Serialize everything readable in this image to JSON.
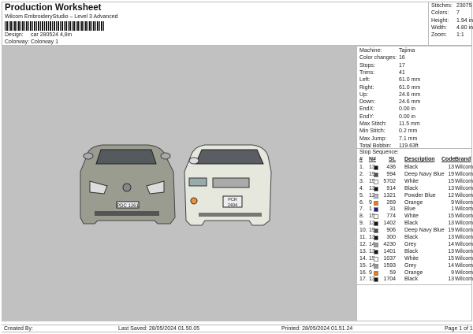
{
  "header": {
    "title": "Production Worksheet",
    "subtitle": "Wilcom EmbroideryStudio – Level 3 Advanced",
    "design_label": "Design:",
    "design_value": "car 280524 4,8in",
    "colorway_label": "Colorway:",
    "colorway_value": "Colorway 1"
  },
  "stats": [
    {
      "label": "Stitches:",
      "value": "23075"
    },
    {
      "label": "Colors:",
      "value": "7"
    },
    {
      "label": "Height:",
      "value": "1.94 in"
    },
    {
      "label": "Width:",
      "value": "4.80 in"
    },
    {
      "label": "Zoom:",
      "value": "1:1"
    }
  ],
  "info": [
    {
      "label": "Machine:",
      "value": "Tajima"
    },
    {
      "label": "Color changes:",
      "value": "16"
    },
    {
      "label": "Stops:",
      "value": "17"
    },
    {
      "label": "Trims:",
      "value": "41"
    },
    {
      "label": "Left:",
      "value": "61.0 mm"
    },
    {
      "label": "Right:",
      "value": "61.0 mm"
    },
    {
      "label": "Up:",
      "value": "24.6 mm"
    },
    {
      "label": "Down:",
      "value": "24.6 mm"
    },
    {
      "label": "EndX:",
      "value": "0.00 in"
    },
    {
      "label": "EndY:",
      "value": "0.00 in"
    },
    {
      "label": "Max Stitch:",
      "value": "11.5 mm"
    },
    {
      "label": "Min Stitch:",
      "value": "0.2 mm"
    },
    {
      "label": "Max Jump:",
      "value": "7.1 mm"
    },
    {
      "label": "Total Bobbin:",
      "value": "119.63ft"
    }
  ],
  "stop_sequence": {
    "title": "Stop Sequence:",
    "headers": [
      "#",
      "N#",
      "St.",
      "Description",
      "Code",
      "Brand"
    ],
    "rows": [
      {
        "n": "1.",
        "needle": "13",
        "color": "#111111",
        "st": "436",
        "desc": "Black",
        "code": "13",
        "brand": "Wilcom"
      },
      {
        "n": "2.",
        "needle": "19",
        "color": "#4a4a66",
        "st": "994",
        "desc": "Deep Navy Blue",
        "code": "19",
        "brand": "Wilcom"
      },
      {
        "n": "3.",
        "needle": "15",
        "color": "#ffffff",
        "st": "5702",
        "desc": "White",
        "code": "15",
        "brand": "Wilcom"
      },
      {
        "n": "4.",
        "needle": "13",
        "color": "#111111",
        "st": "914",
        "desc": "Black",
        "code": "13",
        "brand": "Wilcom"
      },
      {
        "n": "5.",
        "needle": "12",
        "color": "#b8b8e0",
        "st": "1321",
        "desc": "Powder Blue",
        "code": "12",
        "brand": "Wilcom"
      },
      {
        "n": "6.",
        "needle": "9",
        "color": "#f07a10",
        "st": "269",
        "desc": "Orange",
        "code": "9",
        "brand": "Wilcom"
      },
      {
        "n": "7.",
        "needle": "1",
        "color": "#1a1a80",
        "st": "31",
        "desc": "Blue",
        "code": "1",
        "brand": "Wilcom"
      },
      {
        "n": "8.",
        "needle": "15",
        "color": "#ffffff",
        "st": "774",
        "desc": "White",
        "code": "15",
        "brand": "Wilcom"
      },
      {
        "n": "9.",
        "needle": "13",
        "color": "#111111",
        "st": "1402",
        "desc": "Black",
        "code": "13",
        "brand": "Wilcom"
      },
      {
        "n": "10.",
        "needle": "19",
        "color": "#4a4a66",
        "st": "906",
        "desc": "Deep Navy Blue",
        "code": "19",
        "brand": "Wilcom"
      },
      {
        "n": "11.",
        "needle": "13",
        "color": "#111111",
        "st": "300",
        "desc": "Black",
        "code": "13",
        "brand": "Wilcom"
      },
      {
        "n": "12.",
        "needle": "14",
        "color": "#999999",
        "st": "4230",
        "desc": "Grey",
        "code": "14",
        "brand": "Wilcom"
      },
      {
        "n": "13.",
        "needle": "13",
        "color": "#111111",
        "st": "1401",
        "desc": "Black",
        "code": "13",
        "brand": "Wilcom"
      },
      {
        "n": "14.",
        "needle": "15",
        "color": "#ffffff",
        "st": "1037",
        "desc": "White",
        "code": "15",
        "brand": "Wilcom"
      },
      {
        "n": "15.",
        "needle": "14",
        "color": "#999999",
        "st": "1593",
        "desc": "Grey",
        "code": "14",
        "brand": "Wilcom"
      },
      {
        "n": "16.",
        "needle": "9",
        "color": "#f07a10",
        "st": "59",
        "desc": "Orange",
        "code": "9",
        "brand": "Wilcom"
      },
      {
        "n": "17.",
        "needle": "13",
        "color": "#111111",
        "st": "1704",
        "desc": "Black",
        "code": "13",
        "brand": "Wilcom"
      }
    ]
  },
  "plates": {
    "car1": "PDC 1261",
    "car2_top": "PCR",
    "car2_bottom": "2494"
  },
  "footer": {
    "created_by": "Created By:",
    "last_saved": "Last Saved: 28/05/2024 01.50.05",
    "printed": "Printed: 28/05/2024 01.51.24",
    "page": "Page 1 of 1"
  }
}
